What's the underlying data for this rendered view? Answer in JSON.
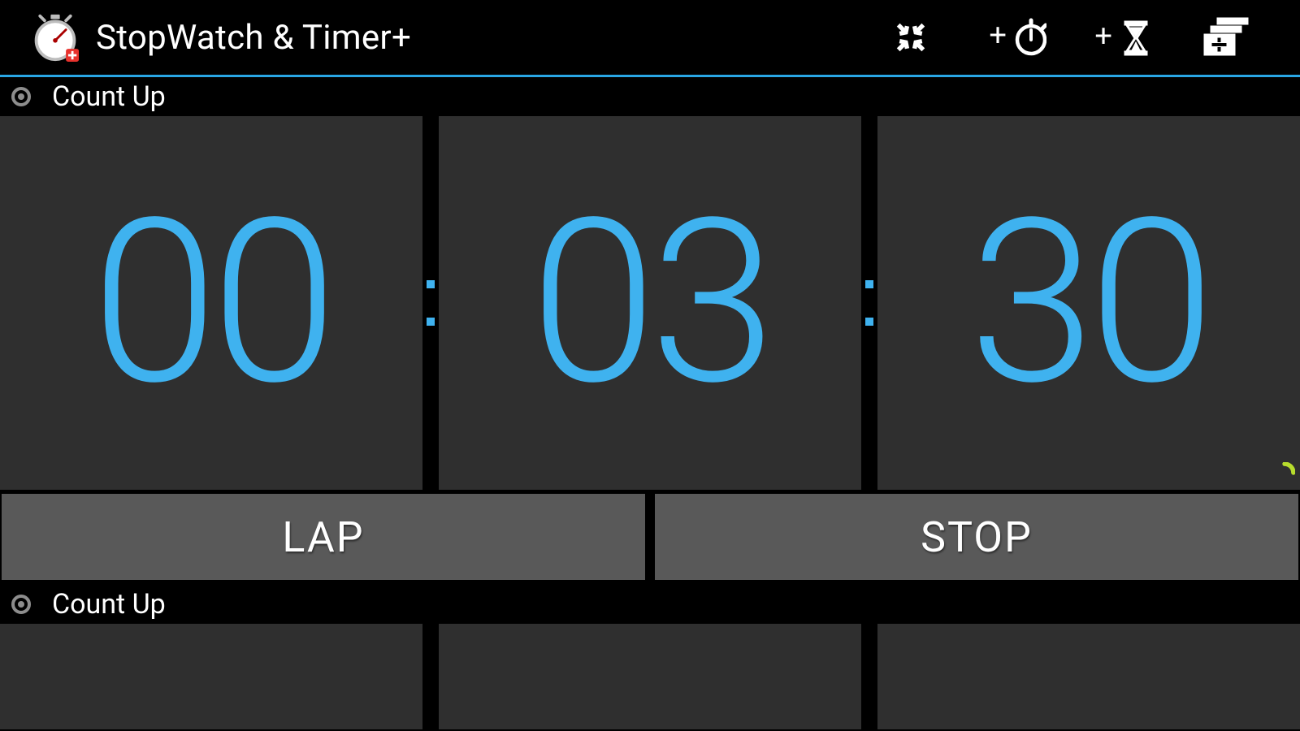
{
  "app": {
    "title": "StopWatch & Timer+"
  },
  "accent": "#29a6e4",
  "timer1": {
    "mode_label": "Count Up",
    "hours": "00",
    "minutes": "03",
    "seconds": "30",
    "buttons": {
      "lap": "LAP",
      "stop": "STOP"
    }
  },
  "timer2": {
    "mode_label": "Count Up"
  },
  "actionbar_icons": [
    "collapse-icon",
    "add-stopwatch-icon",
    "add-hourglass-icon",
    "add-pane-icon"
  ]
}
